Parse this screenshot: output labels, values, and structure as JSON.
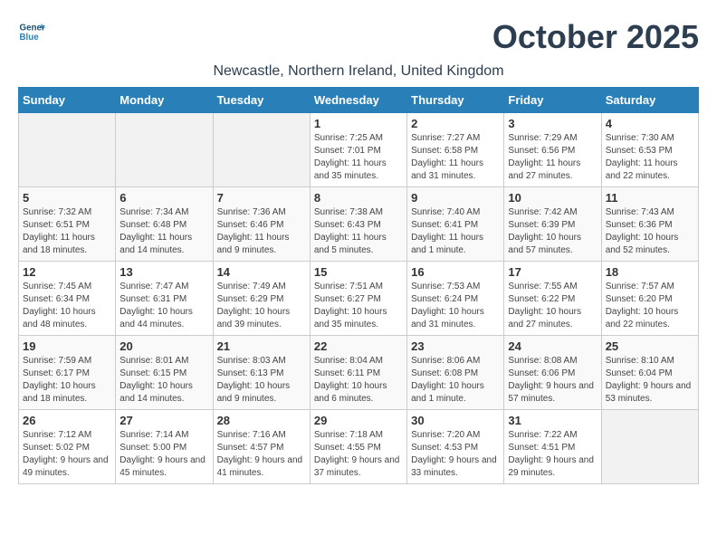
{
  "header": {
    "logo_line1": "General",
    "logo_line2": "Blue",
    "month_year": "October 2025",
    "location": "Newcastle, Northern Ireland, United Kingdom"
  },
  "columns": [
    "Sunday",
    "Monday",
    "Tuesday",
    "Wednesday",
    "Thursday",
    "Friday",
    "Saturday"
  ],
  "weeks": [
    [
      {
        "day": "",
        "info": ""
      },
      {
        "day": "",
        "info": ""
      },
      {
        "day": "",
        "info": ""
      },
      {
        "day": "1",
        "info": "Sunrise: 7:25 AM\nSunset: 7:01 PM\nDaylight: 11 hours and 35 minutes."
      },
      {
        "day": "2",
        "info": "Sunrise: 7:27 AM\nSunset: 6:58 PM\nDaylight: 11 hours and 31 minutes."
      },
      {
        "day": "3",
        "info": "Sunrise: 7:29 AM\nSunset: 6:56 PM\nDaylight: 11 hours and 27 minutes."
      },
      {
        "day": "4",
        "info": "Sunrise: 7:30 AM\nSunset: 6:53 PM\nDaylight: 11 hours and 22 minutes."
      }
    ],
    [
      {
        "day": "5",
        "info": "Sunrise: 7:32 AM\nSunset: 6:51 PM\nDaylight: 11 hours and 18 minutes."
      },
      {
        "day": "6",
        "info": "Sunrise: 7:34 AM\nSunset: 6:48 PM\nDaylight: 11 hours and 14 minutes."
      },
      {
        "day": "7",
        "info": "Sunrise: 7:36 AM\nSunset: 6:46 PM\nDaylight: 11 hours and 9 minutes."
      },
      {
        "day": "8",
        "info": "Sunrise: 7:38 AM\nSunset: 6:43 PM\nDaylight: 11 hours and 5 minutes."
      },
      {
        "day": "9",
        "info": "Sunrise: 7:40 AM\nSunset: 6:41 PM\nDaylight: 11 hours and 1 minute."
      },
      {
        "day": "10",
        "info": "Sunrise: 7:42 AM\nSunset: 6:39 PM\nDaylight: 10 hours and 57 minutes."
      },
      {
        "day": "11",
        "info": "Sunrise: 7:43 AM\nSunset: 6:36 PM\nDaylight: 10 hours and 52 minutes."
      }
    ],
    [
      {
        "day": "12",
        "info": "Sunrise: 7:45 AM\nSunset: 6:34 PM\nDaylight: 10 hours and 48 minutes."
      },
      {
        "day": "13",
        "info": "Sunrise: 7:47 AM\nSunset: 6:31 PM\nDaylight: 10 hours and 44 minutes."
      },
      {
        "day": "14",
        "info": "Sunrise: 7:49 AM\nSunset: 6:29 PM\nDaylight: 10 hours and 39 minutes."
      },
      {
        "day": "15",
        "info": "Sunrise: 7:51 AM\nSunset: 6:27 PM\nDaylight: 10 hours and 35 minutes."
      },
      {
        "day": "16",
        "info": "Sunrise: 7:53 AM\nSunset: 6:24 PM\nDaylight: 10 hours and 31 minutes."
      },
      {
        "day": "17",
        "info": "Sunrise: 7:55 AM\nSunset: 6:22 PM\nDaylight: 10 hours and 27 minutes."
      },
      {
        "day": "18",
        "info": "Sunrise: 7:57 AM\nSunset: 6:20 PM\nDaylight: 10 hours and 22 minutes."
      }
    ],
    [
      {
        "day": "19",
        "info": "Sunrise: 7:59 AM\nSunset: 6:17 PM\nDaylight: 10 hours and 18 minutes."
      },
      {
        "day": "20",
        "info": "Sunrise: 8:01 AM\nSunset: 6:15 PM\nDaylight: 10 hours and 14 minutes."
      },
      {
        "day": "21",
        "info": "Sunrise: 8:03 AM\nSunset: 6:13 PM\nDaylight: 10 hours and 9 minutes."
      },
      {
        "day": "22",
        "info": "Sunrise: 8:04 AM\nSunset: 6:11 PM\nDaylight: 10 hours and 6 minutes."
      },
      {
        "day": "23",
        "info": "Sunrise: 8:06 AM\nSunset: 6:08 PM\nDaylight: 10 hours and 1 minute."
      },
      {
        "day": "24",
        "info": "Sunrise: 8:08 AM\nSunset: 6:06 PM\nDaylight: 9 hours and 57 minutes."
      },
      {
        "day": "25",
        "info": "Sunrise: 8:10 AM\nSunset: 6:04 PM\nDaylight: 9 hours and 53 minutes."
      }
    ],
    [
      {
        "day": "26",
        "info": "Sunrise: 7:12 AM\nSunset: 5:02 PM\nDaylight: 9 hours and 49 minutes."
      },
      {
        "day": "27",
        "info": "Sunrise: 7:14 AM\nSunset: 5:00 PM\nDaylight: 9 hours and 45 minutes."
      },
      {
        "day": "28",
        "info": "Sunrise: 7:16 AM\nSunset: 4:57 PM\nDaylight: 9 hours and 41 minutes."
      },
      {
        "day": "29",
        "info": "Sunrise: 7:18 AM\nSunset: 4:55 PM\nDaylight: 9 hours and 37 minutes."
      },
      {
        "day": "30",
        "info": "Sunrise: 7:20 AM\nSunset: 4:53 PM\nDaylight: 9 hours and 33 minutes."
      },
      {
        "day": "31",
        "info": "Sunrise: 7:22 AM\nSunset: 4:51 PM\nDaylight: 9 hours and 29 minutes."
      },
      {
        "day": "",
        "info": ""
      }
    ]
  ]
}
